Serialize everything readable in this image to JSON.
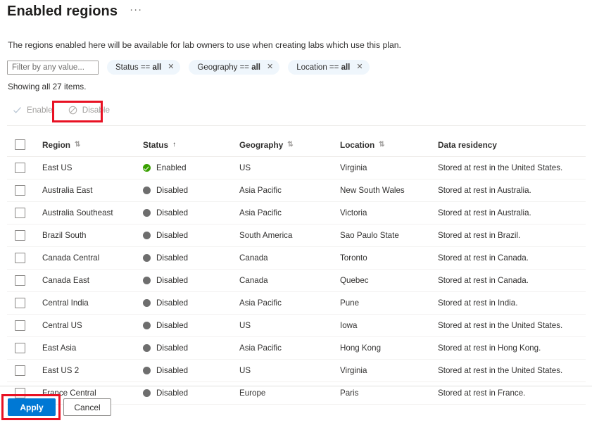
{
  "header": {
    "title": "Enabled regions",
    "ellipsis_label": "···",
    "ellipsis_name": "more-options-icon"
  },
  "description": "The regions enabled here will be available for lab owners to use when creating labs which use this plan.",
  "filters": {
    "input_placeholder": "Filter by any value...",
    "input_value": "",
    "pills": [
      {
        "field": "Status",
        "operator": "==",
        "value": "all",
        "close": "✕"
      },
      {
        "field": "Geography",
        "operator": "==",
        "value": "all",
        "close": "✕"
      },
      {
        "field": "Location",
        "operator": "==",
        "value": "all",
        "close": "✕"
      }
    ]
  },
  "showing_count": "Showing all 27 items.",
  "command_bar": {
    "enable_label": "Enable",
    "enable_icon": "checkmark-icon",
    "enable_disabled": true,
    "disable_label": "Disable",
    "disable_icon": "block-circle-icon",
    "disable_disabled": true
  },
  "table": {
    "columns": [
      {
        "key": "checkbox",
        "label": "",
        "sortable": false
      },
      {
        "key": "region",
        "label": "Region",
        "sort": "unsorted",
        "sort_glyph": "⇅"
      },
      {
        "key": "status",
        "label": "Status",
        "sort": "asc",
        "sort_glyph": "↑"
      },
      {
        "key": "geography",
        "label": "Geography",
        "sort": "unsorted",
        "sort_glyph": "⇅"
      },
      {
        "key": "location",
        "label": "Location",
        "sort": "unsorted",
        "sort_glyph": "⇅"
      },
      {
        "key": "data_residency",
        "label": "Data residency",
        "sortable": false
      }
    ],
    "header_checkbox_checked": false,
    "rows": [
      {
        "checked": false,
        "region": "East US",
        "status": "Enabled",
        "status_state": "enabled",
        "geography": "US",
        "location": "Virginia",
        "data_residency": "Stored at rest in the United States."
      },
      {
        "checked": false,
        "region": "Australia East",
        "status": "Disabled",
        "status_state": "disabled",
        "geography": "Asia Pacific",
        "location": "New South Wales",
        "data_residency": "Stored at rest in Australia."
      },
      {
        "checked": false,
        "region": "Australia Southeast",
        "status": "Disabled",
        "status_state": "disabled",
        "geography": "Asia Pacific",
        "location": "Victoria",
        "data_residency": "Stored at rest in Australia."
      },
      {
        "checked": false,
        "region": "Brazil South",
        "status": "Disabled",
        "status_state": "disabled",
        "geography": "South America",
        "location": "Sao Paulo State",
        "data_residency": "Stored at rest in Brazil."
      },
      {
        "checked": false,
        "region": "Canada Central",
        "status": "Disabled",
        "status_state": "disabled",
        "geography": "Canada",
        "location": "Toronto",
        "data_residency": "Stored at rest in Canada."
      },
      {
        "checked": false,
        "region": "Canada East",
        "status": "Disabled",
        "status_state": "disabled",
        "geography": "Canada",
        "location": "Quebec",
        "data_residency": "Stored at rest in Canada."
      },
      {
        "checked": false,
        "region": "Central India",
        "status": "Disabled",
        "status_state": "disabled",
        "geography": "Asia Pacific",
        "location": "Pune",
        "data_residency": "Stored at rest in India."
      },
      {
        "checked": false,
        "region": "Central US",
        "status": "Disabled",
        "status_state": "disabled",
        "geography": "US",
        "location": "Iowa",
        "data_residency": "Stored at rest in the United States."
      },
      {
        "checked": false,
        "region": "East Asia",
        "status": "Disabled",
        "status_state": "disabled",
        "geography": "Asia Pacific",
        "location": "Hong Kong",
        "data_residency": "Stored at rest in Hong Kong."
      },
      {
        "checked": false,
        "region": "East US 2",
        "status": "Disabled",
        "status_state": "disabled",
        "geography": "US",
        "location": "Virginia",
        "data_residency": "Stored at rest in the United States."
      },
      {
        "checked": false,
        "region": "France Central",
        "status": "Disabled",
        "status_state": "disabled",
        "geography": "Europe",
        "location": "Paris",
        "data_residency": "Stored at rest in France."
      }
    ]
  },
  "footer": {
    "apply_label": "Apply",
    "cancel_label": "Cancel"
  },
  "colors": {
    "accent": "#0078d4",
    "enabled_green": "#39a000",
    "disabled_gray": "#6e6e6e",
    "pill_bg": "#eff6fc",
    "annotation_red": "#e81123"
  }
}
